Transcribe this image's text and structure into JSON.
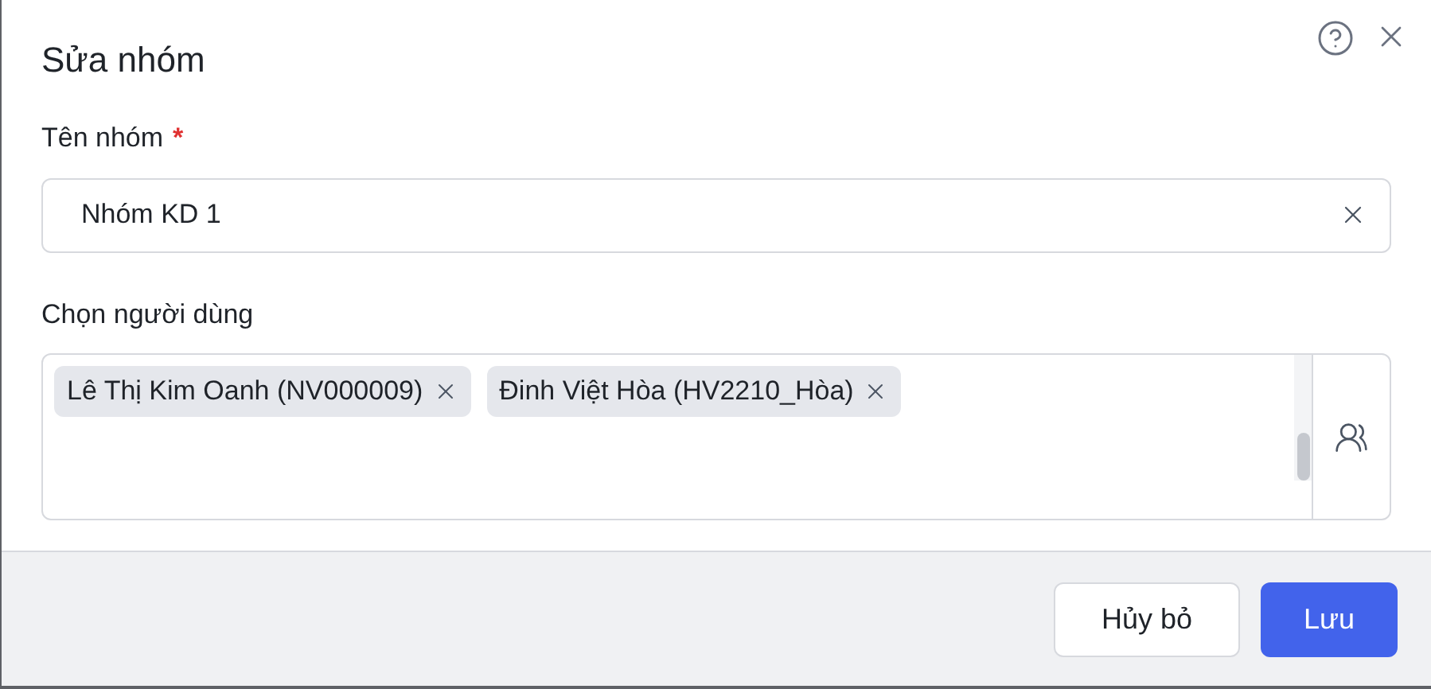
{
  "dialog": {
    "title": "Sửa nhóm"
  },
  "name_field": {
    "label": "Tên nhóm",
    "required_mark": "*",
    "value": "Nhóm KD 1"
  },
  "users_field": {
    "label": "Chọn người dùng",
    "tags": [
      {
        "text": "Lê Thị Kim Oanh (NV000009)"
      },
      {
        "text": "Đinh Việt Hòa (HV2210_Hòa)"
      }
    ]
  },
  "buttons": [
    {
      "label": "Hủy bỏ",
      "kind": "secondary"
    },
    {
      "label": "Lưu",
      "kind": "primary"
    }
  ]
}
